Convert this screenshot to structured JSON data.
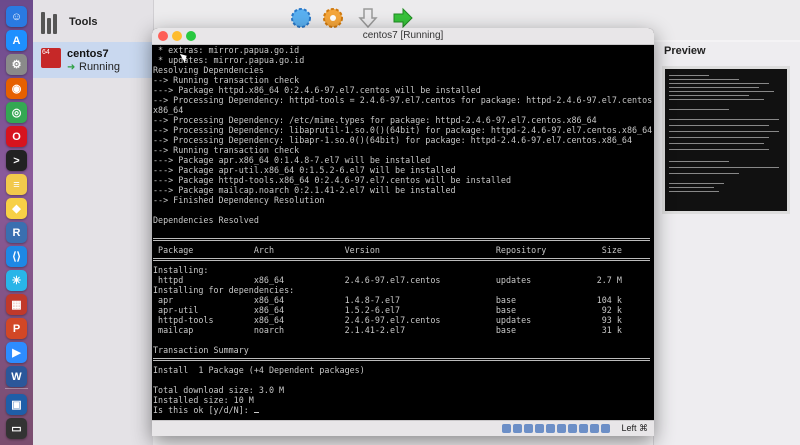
{
  "dock": {
    "icons": [
      {
        "name": "finder-icon",
        "color": "#2a7ae2",
        "glyph": "☺"
      },
      {
        "name": "app-store-icon",
        "color": "#1e90ff",
        "glyph": "A"
      },
      {
        "name": "system-preferences-icon",
        "color": "#8a8a8a",
        "glyph": "⚙"
      },
      {
        "name": "firefox-icon",
        "color": "#e66000",
        "glyph": "◉"
      },
      {
        "name": "chrome-icon",
        "color": "#34a853",
        "glyph": "◎"
      },
      {
        "name": "opera-icon",
        "color": "#d7131f",
        "glyph": "O"
      },
      {
        "name": "terminal-icon",
        "color": "#222222",
        "glyph": ">"
      },
      {
        "name": "notes-icon",
        "color": "#f2c94c",
        "glyph": "≡"
      },
      {
        "name": "cyberduck-icon",
        "color": "#f7d046",
        "glyph": "◆"
      },
      {
        "name": "r-icon",
        "color": "#3a6fb0",
        "glyph": "R"
      },
      {
        "name": "vscode-icon",
        "color": "#1e88e5",
        "glyph": "⟨⟩"
      },
      {
        "name": "snowflake-app-icon",
        "color": "#29b5e8",
        "glyph": "✳"
      },
      {
        "name": "grid-app-icon",
        "color": "#c0392b",
        "glyph": "▦"
      },
      {
        "name": "powerpoint-icon",
        "color": "#d24726",
        "glyph": "P"
      },
      {
        "name": "zoom-icon",
        "color": "#2d8cff",
        "glyph": "▶"
      },
      {
        "name": "word-icon",
        "color": "#2b579a",
        "glyph": "W"
      },
      {
        "name": "virtualbox-icon",
        "color": "#1f5ea8",
        "glyph": "▣"
      },
      {
        "name": "screenshot-icon",
        "color": "#333333",
        "glyph": "▭"
      }
    ]
  },
  "manager": {
    "tools_label": "Tools",
    "vm_name": "centos7",
    "vm_state": "Running",
    "preview_title": "Preview"
  },
  "vm_window": {
    "title": "centos7 [Running]",
    "host_key": "Left ⌘",
    "console_lines": [
      " * extras: mirror.papua.go.id",
      " * updates: mirror.papua.go.id",
      "Resolving Dependencies",
      "--> Running transaction check",
      "---> Package httpd.x86_64 0:2.4.6-97.el7.centos will be installed",
      "--> Processing Dependency: httpd-tools = 2.4.6-97.el7.centos for package: httpd-2.4.6-97.el7.centos.",
      "x86_64",
      "--> Processing Dependency: /etc/mime.types for package: httpd-2.4.6-97.el7.centos.x86_64",
      "--> Processing Dependency: libaprutil-1.so.0()(64bit) for package: httpd-2.4.6-97.el7.centos.x86_64",
      "--> Processing Dependency: libapr-1.so.0()(64bit) for package: httpd-2.4.6-97.el7.centos.x86_64",
      "--> Running transaction check",
      "---> Package apr.x86_64 0:1.4.8-7.el7 will be installed",
      "---> Package apr-util.x86_64 0:1.5.2-6.el7 will be installed",
      "---> Package httpd-tools.x86_64 0:2.4.6-97.el7.centos will be installed",
      "---> Package mailcap.noarch 0:2.1.41-2.el7 will be installed",
      "--> Finished Dependency Resolution",
      "",
      "Dependencies Resolved",
      "",
      "@RULE",
      " Package            Arch              Version                       Repository           Size",
      "@RULE",
      "Installing:",
      " httpd              x86_64            2.4.6-97.el7.centos           updates             2.7 M",
      "Installing for dependencies:",
      " apr                x86_64            1.4.8-7.el7                   base                104 k",
      " apr-util           x86_64            1.5.2-6.el7                   base                 92 k",
      " httpd-tools        x86_64            2.4.6-97.el7.centos           updates              93 k",
      " mailcap            noarch            2.1.41-2.el7                  base                 31 k",
      "",
      "Transaction Summary",
      "@RULE",
      "Install  1 Package (+4 Dependent packages)",
      "",
      "Total download size: 3.0 M",
      "Installed size: 10 M",
      "Is this ok [y/d/N]: "
    ]
  }
}
